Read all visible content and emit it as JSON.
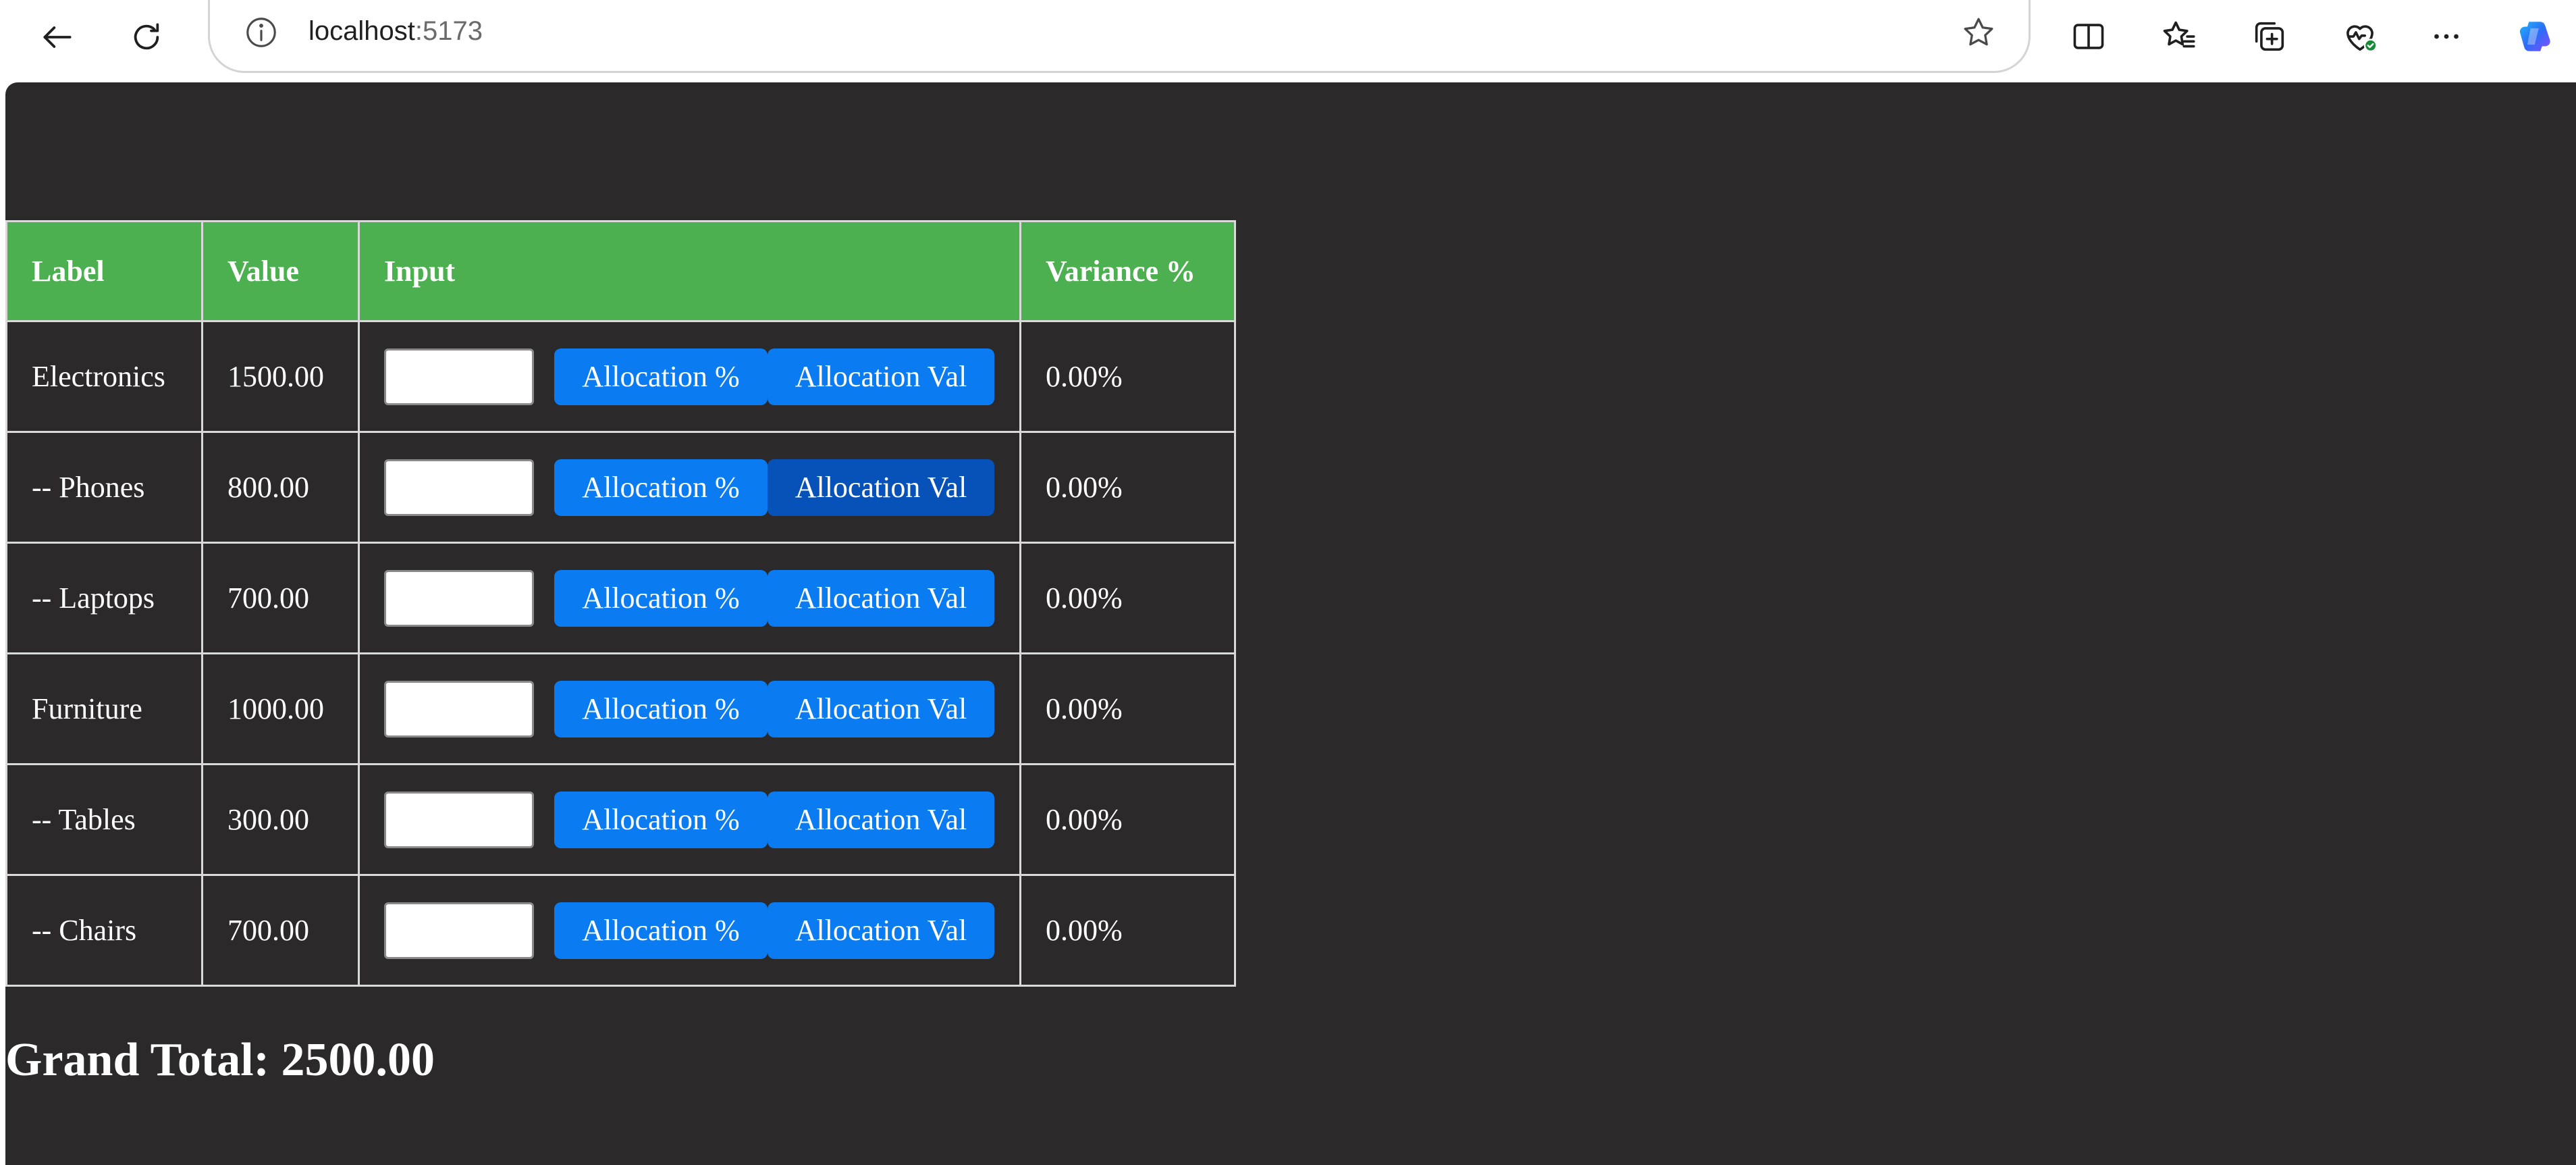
{
  "browser": {
    "url_host": "localhost",
    "url_port": ":5173"
  },
  "table": {
    "headers": {
      "label": "Label",
      "value": "Value",
      "input": "Input",
      "variance": "Variance %"
    },
    "rows": [
      {
        "label": "Electronics",
        "value": "1500.00",
        "input": "",
        "btn_pct": "Allocation %",
        "btn_val": "Allocation Val",
        "variance": "0.00%"
      },
      {
        "label": "-- Phones",
        "value": "800.00",
        "input": "",
        "btn_pct": "Allocation %",
        "btn_val": "Allocation Val",
        "variance": "0.00%"
      },
      {
        "label": "-- Laptops",
        "value": "700.00",
        "input": "",
        "btn_pct": "Allocation %",
        "btn_val": "Allocation Val",
        "variance": "0.00%"
      },
      {
        "label": "Furniture",
        "value": "1000.00",
        "input": "",
        "btn_pct": "Allocation %",
        "btn_val": "Allocation Val",
        "variance": "0.00%"
      },
      {
        "label": "-- Tables",
        "value": "300.00",
        "input": "",
        "btn_pct": "Allocation %",
        "btn_val": "Allocation Val",
        "variance": "0.00%"
      },
      {
        "label": "-- Chairs",
        "value": "700.00",
        "input": "",
        "btn_pct": "Allocation %",
        "btn_val": "Allocation Val",
        "variance": "0.00%"
      }
    ]
  },
  "grand_total": "Grand Total: 2500.00",
  "colors": {
    "header_bg": "#4caf50",
    "button_bg": "#0a7bf0",
    "button_hover_bg": "#0652b8",
    "page_bg": "#2b292a"
  },
  "icons": {
    "back": "back-arrow-icon",
    "reload": "reload-icon",
    "info": "info-icon",
    "favorite": "star-icon",
    "split": "split-screen-icon",
    "favorites": "favorites-icon",
    "collections": "collections-icon",
    "health": "browser-essentials-icon",
    "more": "more-icon",
    "copilot": "copilot-icon"
  }
}
